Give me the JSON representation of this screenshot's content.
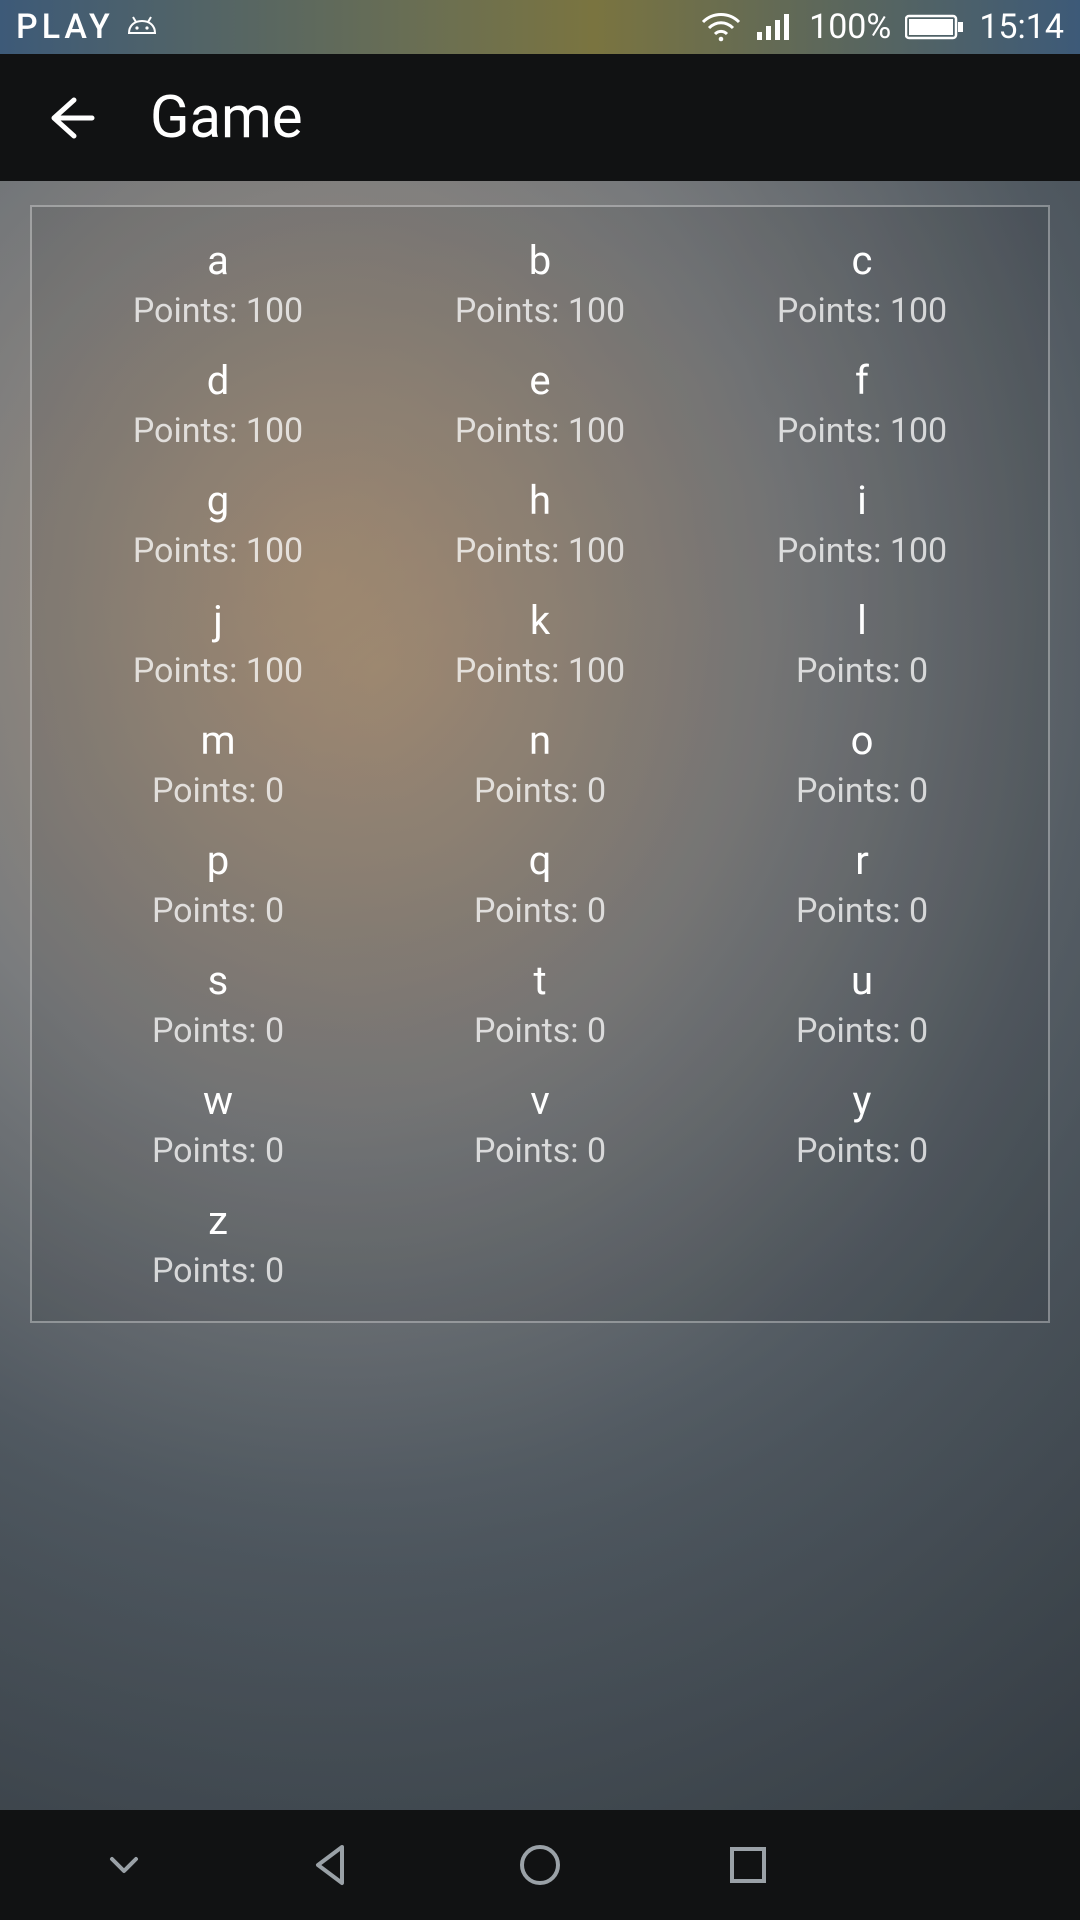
{
  "status_bar": {
    "carrier": "PLAY",
    "battery_percent": "100%",
    "time": "15:14"
  },
  "app_bar": {
    "title": "Game"
  },
  "grid": {
    "points_prefix": "Points: ",
    "cells": [
      {
        "letter": "a",
        "points": 100
      },
      {
        "letter": "b",
        "points": 100
      },
      {
        "letter": "c",
        "points": 100
      },
      {
        "letter": "d",
        "points": 100
      },
      {
        "letter": "e",
        "points": 100
      },
      {
        "letter": "f",
        "points": 100
      },
      {
        "letter": "g",
        "points": 100
      },
      {
        "letter": "h",
        "points": 100
      },
      {
        "letter": "i",
        "points": 100
      },
      {
        "letter": "j",
        "points": 100
      },
      {
        "letter": "k",
        "points": 100
      },
      {
        "letter": "l",
        "points": 0
      },
      {
        "letter": "m",
        "points": 0
      },
      {
        "letter": "n",
        "points": 0
      },
      {
        "letter": "o",
        "points": 0
      },
      {
        "letter": "p",
        "points": 0
      },
      {
        "letter": "q",
        "points": 0
      },
      {
        "letter": "r",
        "points": 0
      },
      {
        "letter": "s",
        "points": 0
      },
      {
        "letter": "t",
        "points": 0
      },
      {
        "letter": "u",
        "points": 0
      },
      {
        "letter": "w",
        "points": 0
      },
      {
        "letter": "v",
        "points": 0
      },
      {
        "letter": "y",
        "points": 0
      },
      {
        "letter": "z",
        "points": 0
      }
    ]
  }
}
